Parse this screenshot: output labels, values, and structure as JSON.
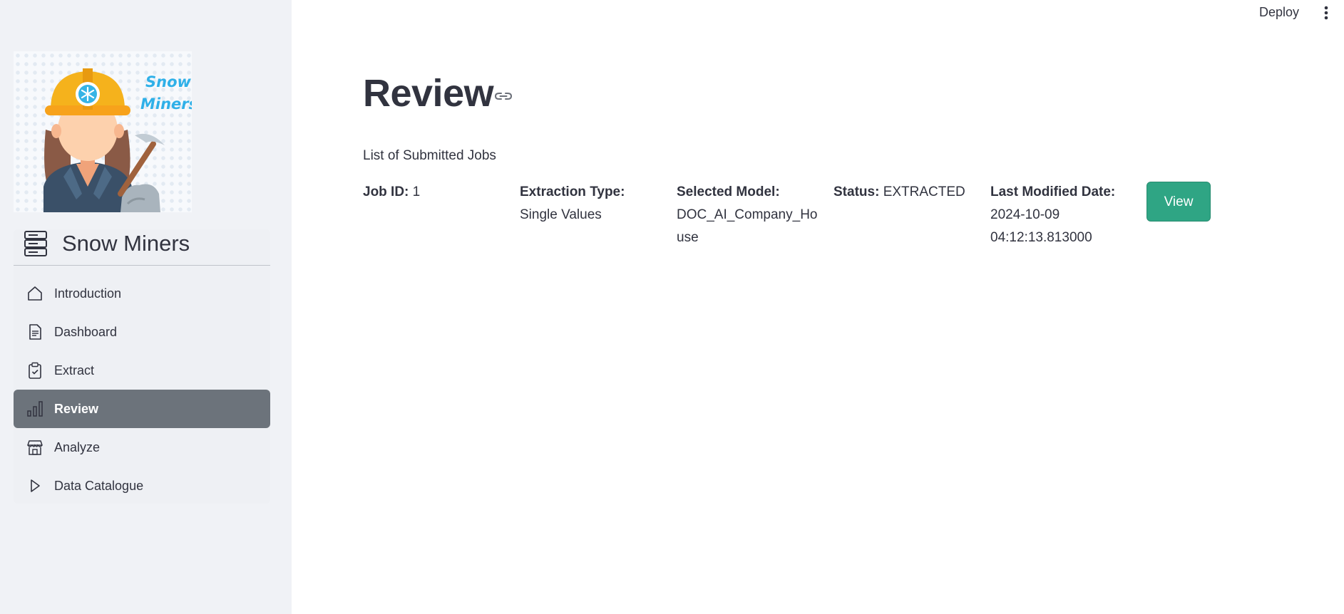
{
  "header": {
    "deploy_label": "Deploy"
  },
  "sidebar": {
    "logo_text_line1": "Snow",
    "logo_text_line2": "Miners",
    "app_name": "Snow Miners",
    "items": [
      {
        "label": "Introduction",
        "icon": "house-icon"
      },
      {
        "label": "Dashboard",
        "icon": "document-icon"
      },
      {
        "label": "Extract",
        "icon": "clipboard-check-icon"
      },
      {
        "label": "Review",
        "icon": "bar-chart-icon",
        "active": true
      },
      {
        "label": "Analyze",
        "icon": "shop-icon"
      },
      {
        "label": "Data Catalogue",
        "icon": "play-icon"
      }
    ]
  },
  "main": {
    "title": "Review",
    "subtitle": "List of Submitted Jobs",
    "job": {
      "job_id_label": "Job ID:",
      "job_id_value": "1",
      "extraction_type_label": "Extraction Type:",
      "extraction_type_value": "Single Values",
      "selected_model_label": "Selected Model:",
      "selected_model_value": "DOC_AI_Company_House",
      "status_label": "Status:",
      "status_value": "EXTRACTED",
      "last_modified_label": "Last Modified Date:",
      "last_modified_value": "2024-10-09 04:12:13.813000",
      "view_label": "View"
    }
  },
  "colors": {
    "sidebar_bg": "#f0f2f6",
    "active_nav_bg": "#6c737b",
    "view_button": "#2fa584",
    "logo_text": "#2fb0e8"
  }
}
